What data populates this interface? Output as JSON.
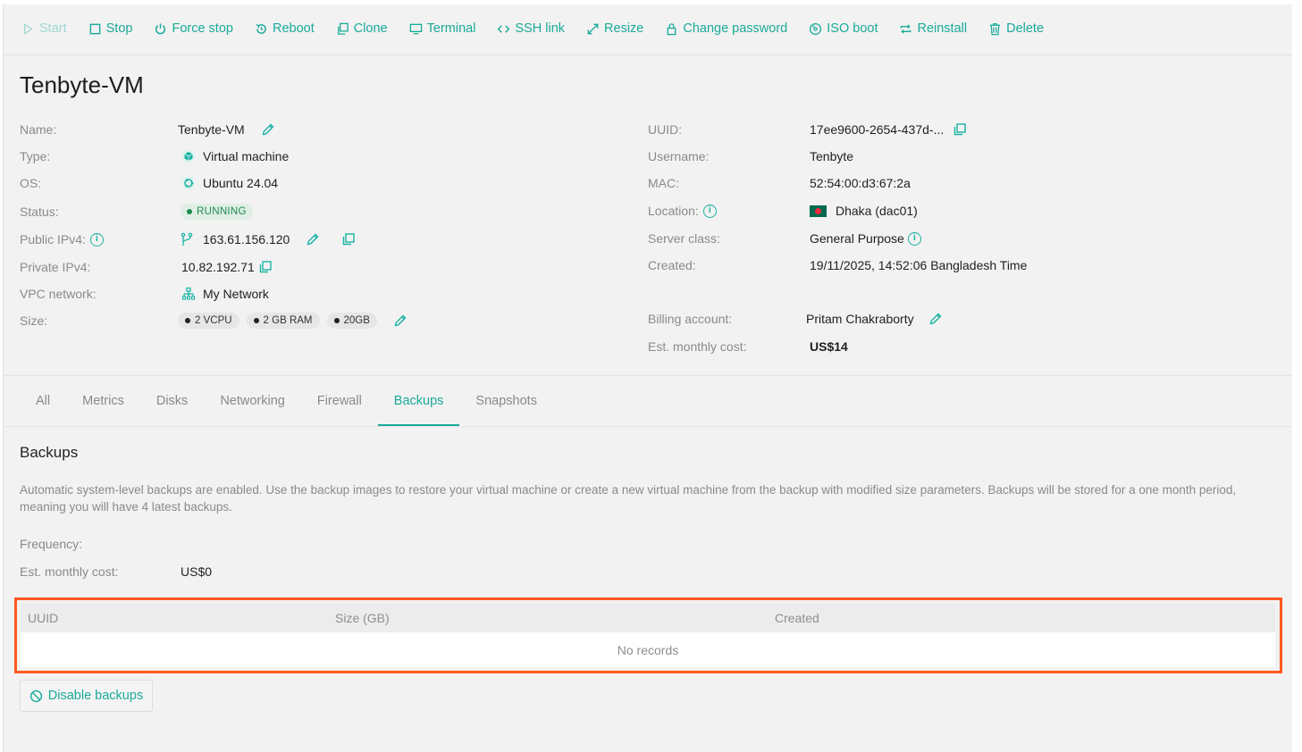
{
  "toolbar": {
    "start": "Start",
    "stop": "Stop",
    "force_stop": "Force stop",
    "reboot": "Reboot",
    "clone": "Clone",
    "terminal": "Terminal",
    "ssh_link": "SSH link",
    "resize": "Resize",
    "change_password": "Change password",
    "iso_boot": "ISO boot",
    "reinstall": "Reinstall",
    "delete": "Delete"
  },
  "vm_title": "Tenbyte-VM",
  "details_left": {
    "name_label": "Name:",
    "name_value": "Tenbyte-VM",
    "type_label": "Type:",
    "type_value": "Virtual machine",
    "os_label": "OS:",
    "os_value": "Ubuntu 24.04",
    "status_label": "Status:",
    "status_value": "RUNNING",
    "public_ipv4_label": "Public IPv4:",
    "public_ipv4_value": "163.61.156.120",
    "private_ipv4_label": "Private IPv4:",
    "private_ipv4_value": "10.82.192.71",
    "vpc_label": "VPC network:",
    "vpc_value": "My Network",
    "size_label": "Size:",
    "size_badges": [
      "2 VCPU",
      "2 GB RAM",
      "20GB"
    ]
  },
  "details_right": {
    "uuid_label": "UUID:",
    "uuid_value": "17ee9600-2654-437d-...",
    "username_label": "Username:",
    "username_value": "Tenbyte",
    "mac_label": "MAC:",
    "mac_value": "52:54:00:d3:67:2a",
    "location_label": "Location:",
    "location_value": "Dhaka (dac01)",
    "server_class_label": "Server class:",
    "server_class_value": "General Purpose",
    "created_label": "Created:",
    "created_value": "19/11/2025, 14:52:06 Bangladesh Time",
    "billing_label": "Billing account:",
    "billing_value": "Pritam Chakraborty",
    "cost_label": "Est. monthly cost:",
    "cost_value": "US$14"
  },
  "tabs": [
    "All",
    "Metrics",
    "Disks",
    "Networking",
    "Firewall",
    "Backups",
    "Snapshots"
  ],
  "active_tab": "Backups",
  "backups": {
    "title": "Backups",
    "description": "Automatic system-level backups are enabled. Use the backup images to restore your virtual machine or create a new virtual machine from the backup with modified size parameters. Backups will be stored for a one month period, meaning you will have 4 latest backups.",
    "frequency_label": "Frequency:",
    "frequency_value": "",
    "cost_label": "Est. monthly cost:",
    "cost_value": "US$0",
    "table": {
      "columns": [
        "UUID",
        "Size (GB)",
        "Created"
      ],
      "empty_text": "No records"
    },
    "disable_button": "Disable backups"
  },
  "colors": {
    "accent": "#1aaa99",
    "highlight": "#ff5a1f",
    "running": "#1d8a4d"
  }
}
